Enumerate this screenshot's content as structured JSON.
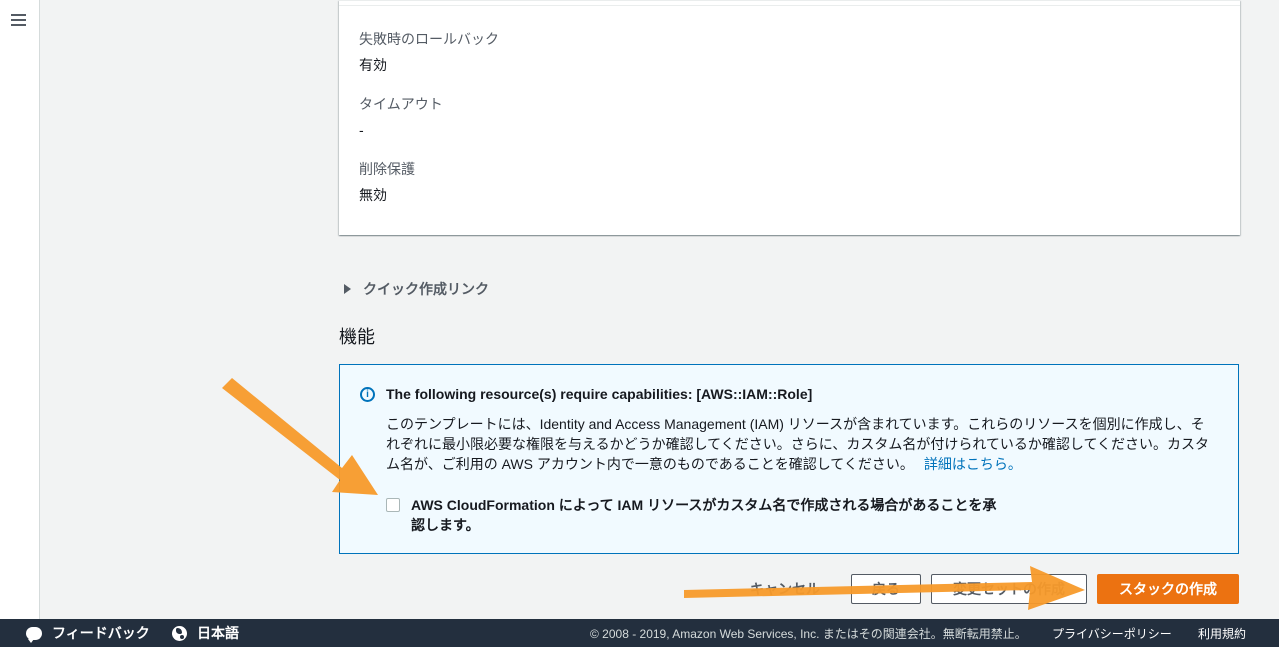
{
  "details": {
    "fields": [
      {
        "label": "失敗時のロールバック",
        "value": "有効"
      },
      {
        "label": "タイムアウト",
        "value": "-"
      },
      {
        "label": "削除保護",
        "value": "無効"
      }
    ]
  },
  "quick_link": {
    "label": "クイック作成リンク"
  },
  "capabilities": {
    "heading": "機能",
    "alert_title": "The following resource(s) require capabilities: [AWS::IAM::Role]",
    "alert_body_lines": [
      "このテンプレートには、Identity and Access Management (IAM) リソースが含まれています。これらのリソースを個別に作成し、そ",
      "れぞれに最小限必要な権限を与えるかどうか確認してください。さらに、カスタム名が付けられているか確認してください。カスタ",
      "ム名が、ご利用の AWS アカウント内で一意のものであることを確認してください。"
    ],
    "learn_more": "詳細はこちら。",
    "ack_lines": [
      "AWS CloudFormation によって IAM リソースがカスタム名で作成される場合があることを承",
      "認します。"
    ],
    "ack_checked": false
  },
  "actions": {
    "cancel": "キャンセル",
    "back": "戻る",
    "create_changeset": "変更セットの作成",
    "create_stack": "スタックの作成"
  },
  "footer": {
    "feedback": "フィードバック",
    "language": "日本語",
    "copyright": "© 2008 - 2019, Amazon Web Services, Inc. またはその関連会社。無断転用禁止。",
    "privacy": "プライバシーポリシー",
    "terms": "利用規約"
  },
  "colors": {
    "primary": "#ec7211",
    "link": "#0073bb",
    "footer_bg": "#232f3e",
    "annotation_arrow": "#f79a2a"
  }
}
